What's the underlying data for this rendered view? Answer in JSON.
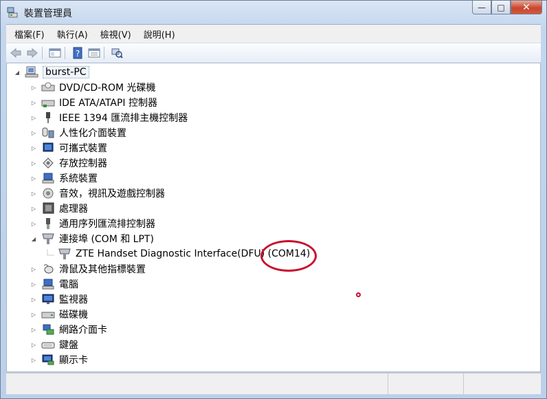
{
  "window": {
    "title": "裝置管理員",
    "controls": {
      "minimize": "—",
      "maximize": "□",
      "close": "✕"
    }
  },
  "menu": [
    "檔案(F)",
    "執行(A)",
    "檢視(V)",
    "說明(H)"
  ],
  "toolbar": [
    "back-icon",
    "forward-icon",
    "properties-icon",
    "help-icon",
    "view-icon",
    "scan-hardware-icon"
  ],
  "tree": {
    "root": "burst-PC",
    "items": [
      {
        "label": "DVD/CD-ROM 光碟機",
        "icon": "dvd-drive-icon",
        "expanded": false
      },
      {
        "label": "IDE ATA/ATAPI 控制器",
        "icon": "ide-controller-icon",
        "expanded": false
      },
      {
        "label": "IEEE 1394 匯流排主機控制器",
        "icon": "ieee1394-icon",
        "expanded": false
      },
      {
        "label": "人性化介面裝置",
        "icon": "hid-icon",
        "expanded": false
      },
      {
        "label": "可攜式裝置",
        "icon": "portable-device-icon",
        "expanded": false
      },
      {
        "label": "存放控制器",
        "icon": "storage-controller-icon",
        "expanded": false
      },
      {
        "label": "系統裝置",
        "icon": "system-device-icon",
        "expanded": false
      },
      {
        "label": "音效，視訊及遊戲控制器",
        "icon": "sound-icon",
        "expanded": false
      },
      {
        "label": "處理器",
        "icon": "processor-icon",
        "expanded": false
      },
      {
        "label": "通用序列匯流排控制器",
        "icon": "usb-icon",
        "expanded": false
      },
      {
        "label": "連接埠 (COM 和 LPT)",
        "icon": "port-icon",
        "expanded": true
      },
      {
        "label": "ZTE Handset Diagnostic Interface(DFU) (COM14)",
        "icon": "port-device-icon",
        "child": true
      },
      {
        "label": "滑鼠及其他指標裝置",
        "icon": "mouse-icon",
        "expanded": false
      },
      {
        "label": "電腦",
        "icon": "computer-icon",
        "expanded": false
      },
      {
        "label": "監視器",
        "icon": "monitor-icon",
        "expanded": false
      },
      {
        "label": "磁碟機",
        "icon": "disk-drive-icon",
        "expanded": false
      },
      {
        "label": "網路介面卡",
        "icon": "network-adapter-icon",
        "expanded": false
      },
      {
        "label": "鍵盤",
        "icon": "keyboard-icon",
        "expanded": false
      },
      {
        "label": "顯示卡",
        "icon": "display-adapter-icon",
        "expanded": false
      }
    ]
  },
  "annotation_color": "#c8102e"
}
